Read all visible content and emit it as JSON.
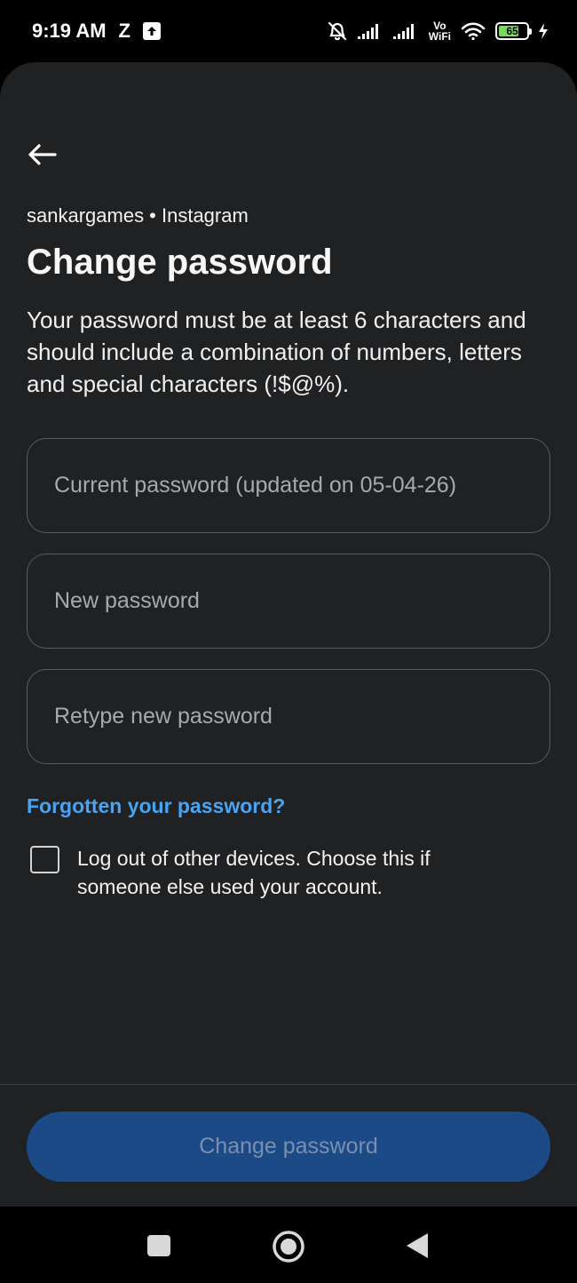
{
  "status_bar": {
    "time": "9:19 AM",
    "carrier_letter": "Z",
    "volte_top": "Vo",
    "volte_bottom": "WiFi",
    "battery_level": "65",
    "icons": [
      "upload-icon",
      "bell-off-icon",
      "signal-icon",
      "signal-icon",
      "wifi-icon",
      "battery-icon",
      "charging-icon"
    ]
  },
  "header": {
    "back_icon": "arrow-left-icon",
    "account_line": "sankargames • Instagram",
    "title": "Change password",
    "description": "Your password must be at least 6 characters and should include a combination of numbers, letters and special characters (!$@%)."
  },
  "form": {
    "current_password": {
      "placeholder": "Current password (updated on 05-04-26)",
      "value": ""
    },
    "new_password": {
      "placeholder": "New password",
      "value": ""
    },
    "retype_password": {
      "placeholder": "Retype new password",
      "value": ""
    },
    "forgot_link": "Forgotten your password?",
    "logout_checkbox": {
      "label": "Log out of other devices. Choose this if someone else used your account.",
      "checked": false
    },
    "submit_label": "Change password",
    "submit_enabled": false
  },
  "nav_bar": {
    "buttons": [
      "recents-icon",
      "home-icon",
      "back-icon"
    ]
  },
  "colors": {
    "background": "#202123",
    "link": "#4aa3f0",
    "button_disabled": "#1c4a87",
    "battery_fill": "#7ad85a"
  }
}
